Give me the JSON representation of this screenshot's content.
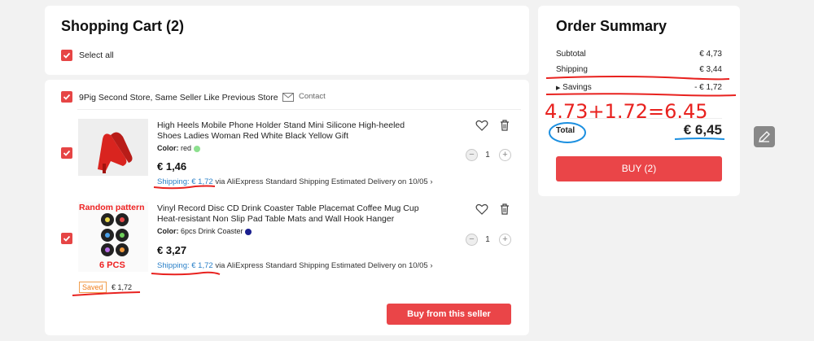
{
  "cart": {
    "title": "Shopping Cart (2)",
    "select_all_label": "Select all"
  },
  "store": {
    "name": "9Pig Second Store, Same Seller Like Previous Store",
    "contact_label": "Contact",
    "saved_badge": "Saved",
    "saved_amount": "€ 1,72",
    "buy_button": "Buy from this seller"
  },
  "items": [
    {
      "title": "High Heels Mobile Phone Holder Stand Mini Silicone High-heeled Shoes Ladies Woman Red White Black Yellow Gift",
      "color_label": "Color:",
      "color_value": "red",
      "color_swatch": "#8de08f",
      "price": "€ 1,46",
      "shipping_label": "Shipping: € 1,72",
      "via": "via AliExpress Standard Shipping",
      "delivery": "Estimated Delivery on 10/05",
      "quantity": "1"
    },
    {
      "title": "Vinyl Record Disc CD Drink Coaster Table Placemat Coffee Mug Cup Heat-resistant Non Slip Pad Table Mats and Wall Hook Hanger",
      "color_label": "Color:",
      "color_value": "6pcs Drink Coaster",
      "color_swatch": "#1a1f8f",
      "price": "€ 3,27",
      "shipping_label": "Shipping: € 1,72",
      "via": "via AliExpress Standard Shipping",
      "delivery": "Estimated Delivery on 10/05",
      "quantity": "1",
      "image_caption_top": "Random pattern",
      "image_caption_bottom": "6 PCS"
    }
  ],
  "summary": {
    "title": "Order Summary",
    "subtotal_label": "Subtotal",
    "subtotal_value": "€ 4,73",
    "shipping_label": "Shipping",
    "shipping_value": "€ 3,44",
    "savings_label": "Savings",
    "savings_value": "- € 1,72",
    "total_label": "Total",
    "total_value": "€ 6,45",
    "buy_button": "BUY (2)"
  },
  "annotation": {
    "formula": "4.73+1.72=6.45"
  },
  "colors": {
    "accent_red": "#ea4548",
    "link_blue": "#2a80c8",
    "annotation_red": "#e8221f",
    "annotation_blue": "#1b8fe0"
  }
}
